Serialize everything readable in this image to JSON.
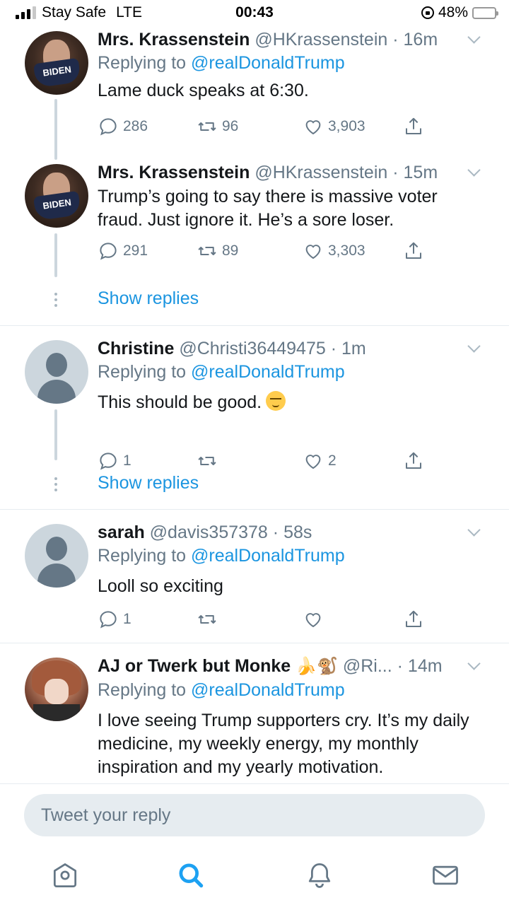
{
  "status_bar": {
    "carrier": "Stay Safe",
    "network": "LTE",
    "time": "00:43",
    "battery": "48%",
    "battery_level": 0.48
  },
  "tweets": [
    {
      "name": "Mrs. Krassenstein",
      "handle": "@HKrassenstein",
      "time": "· 16m",
      "replying_prefix": "Replying to",
      "replying_to": "@realDonaldTrump",
      "text": "Lame duck speaks at 6:30.",
      "replies": "286",
      "retweets": "96",
      "likes": "3,903",
      "avatar_text": "BIDEN"
    },
    {
      "name": "Mrs. Krassenstein",
      "handle": "@HKrassenstein",
      "time": "· 15m",
      "text": "Trump’s going to say there is massive voter fraud.  Just ignore it.  He’s a sore loser.",
      "replies": "291",
      "retweets": "89",
      "likes": "3,303",
      "avatar_text": "BIDEN",
      "show_replies": "Show replies"
    },
    {
      "name": "Christine",
      "handle": "@Christi36449475",
      "time": "· 1m",
      "replying_prefix": "Replying to",
      "replying_to": "@realDonaldTrump",
      "text": "This should be good.",
      "replies": "1",
      "retweets": "",
      "likes": "2",
      "show_replies": "Show replies"
    },
    {
      "name": "sarah",
      "handle": "@davis357378",
      "time": "· 58s",
      "replying_prefix": "Replying to",
      "replying_to": "@realDonaldTrump",
      "text": "Looll so exciting",
      "replies": "1",
      "retweets": "",
      "likes": ""
    },
    {
      "name": "AJ or Twerk but Monke",
      "name_emoji": "🍌🐒",
      "handle": "@Ri...",
      "time": "· 14m",
      "replying_prefix": "Replying to",
      "replying_to": "@realDonaldTrump",
      "text": "I love seeing Trump supporters cry. It’s my daily medicine, my weekly energy, my monthly inspiration and my yearly motivation."
    }
  ],
  "reply_bar": {
    "placeholder": "Tweet your reply"
  },
  "tab_bar": {
    "items": [
      "home-icon",
      "search-icon",
      "notifications-icon",
      "messages-icon"
    ],
    "active_color": "#1da1f2",
    "inactive_color": "#657786"
  }
}
